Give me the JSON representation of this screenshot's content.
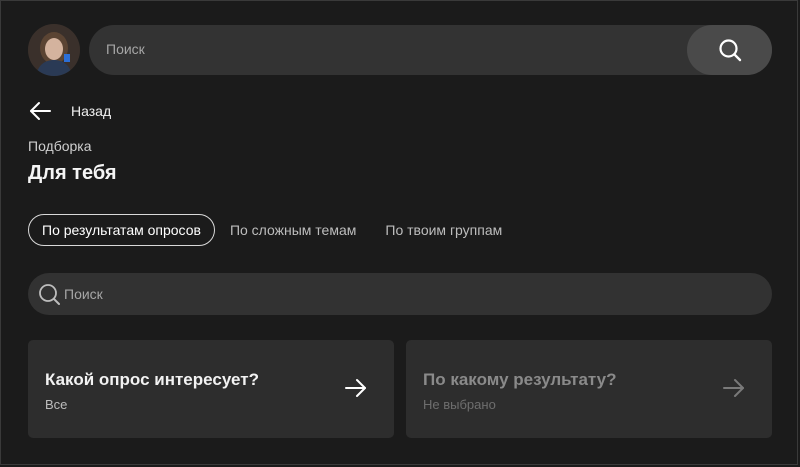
{
  "user": {
    "avatar_icon": "user-avatar"
  },
  "top_search": {
    "placeholder": "Поиск",
    "button_icon": "search-icon"
  },
  "nav": {
    "back_label": "Назад",
    "back_icon": "arrow-left-icon"
  },
  "page": {
    "overline": "Подборка",
    "title": "Для тебя"
  },
  "tabs": [
    {
      "label": "По результатам опросов",
      "active": true
    },
    {
      "label": "По сложным темам",
      "active": false
    },
    {
      "label": "По твоим группам",
      "active": false
    }
  ],
  "filter_search": {
    "placeholder": "Поиск",
    "icon": "search-icon"
  },
  "filters": [
    {
      "title": "Какой опрос интересует?",
      "value": "Все",
      "enabled": true,
      "icon": "arrow-right-icon"
    },
    {
      "title": "По какому результату?",
      "value": "Не выбрано",
      "enabled": false,
      "icon": "arrow-right-icon"
    }
  ],
  "colors": {
    "background": "#1b1b1b",
    "surface": "#2d2d2d",
    "input": "#333333",
    "text": "#ffffff",
    "muted": "#8a8a8a"
  }
}
